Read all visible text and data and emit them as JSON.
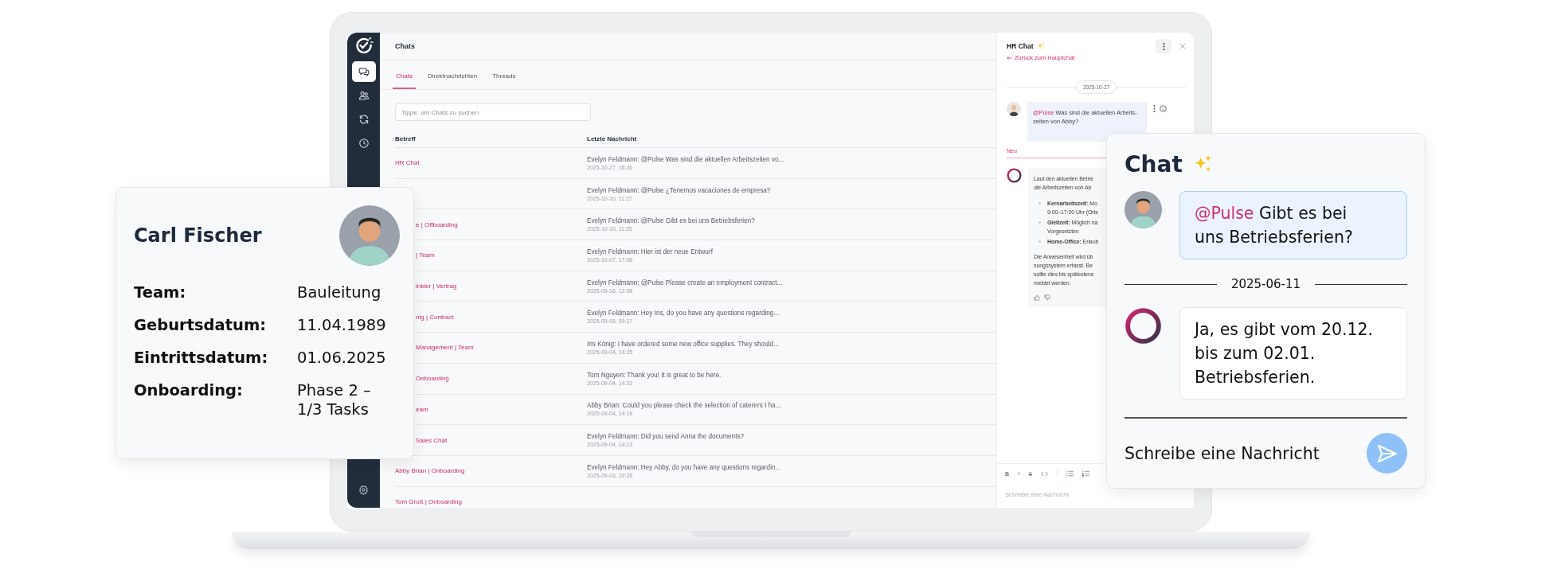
{
  "sidebar": {
    "items": [
      {
        "selected": true
      },
      {
        "selected": false
      },
      {
        "selected": false
      },
      {
        "selected": false
      }
    ]
  },
  "chats": {
    "title": "Chats",
    "tabs": [
      {
        "label": "Chats",
        "selected": true
      },
      {
        "label": "Direktnachrichten",
        "selected": false
      },
      {
        "label": "Threads",
        "selected": false
      }
    ],
    "search": {
      "placeholder": "Tippe, um Chats zu suchen"
    },
    "columns": [
      "Betreff",
      "Letzte Nachricht"
    ],
    "rows": [
      {
        "subject": "HR Chat",
        "covered": false,
        "message": "Evelyn Feldmann: @Pulse Was sind die aktuellen Arbeitszeiten vo...",
        "time": "2025-10-27, 16:26"
      },
      {
        "message": "Evelyn Feldmann: @Pulse ¿Tenemos vacaciones de empresa?",
        "time": "2025-10-10, 11:27"
      },
      {
        "subject": "e | Offboarding",
        "covered": true,
        "message": "Evelyn Feldmann: @Pulse Gibt es bei uns Betriebsferien?",
        "time": "2025-10-10, 11:25"
      },
      {
        "subject": "| Team",
        "covered": true,
        "message": "Evelyn Feldmann: Hier ist der neue Entwurf",
        "time": "2025-10-07, 17:08"
      },
      {
        "subject": "inkler | Vertrag",
        "covered": true,
        "message": "Evelyn Feldmann: @Pulse Please create an employment contract...",
        "time": "2025-09-16, 12:08"
      },
      {
        "subject": "nig | Contract",
        "covered": true,
        "message": "Evelyn Feldmann: Hey Iris, do you have any questions regarding...",
        "time": "2025-09-08, 09:27"
      },
      {
        "subject": "Management | Team",
        "covered": true,
        "message": "Iris König: I have ordered some new office supplies. They should...",
        "time": "2025-09-04, 14:25"
      },
      {
        "subject": "Onboarding",
        "covered": true,
        "message": "Tom Nguyen: Thank you! It is great to be here.",
        "time": "2025-09-04, 14:22"
      },
      {
        "subject": "eam",
        "covered": true,
        "message": "Abby Brian: Could you please check the selection of caterers I ha...",
        "time": "2025-09-04, 14:18"
      },
      {
        "subject": "Sales Chat",
        "covered": true,
        "message": "Evelyn Feldmann: Did you send Anna the documents?",
        "time": "2025-09-04, 14:13"
      },
      {
        "subject": "Abby Brian | Onboarding",
        "covered": false,
        "message": "Evelyn Feldmann: Hey Abby, do you have any questions regardin...",
        "time": "2025-09-03, 10:28"
      },
      {
        "subject": "Tom Groß | Onboarding",
        "covered": false
      }
    ]
  },
  "hr_chat": {
    "title": "HR Chat",
    "back_link": "Zurück zum Hauptchat",
    "date": "2025-10-27",
    "question": {
      "mention": "@Pulse",
      "text": "Was sind die aktuellen Arbeits-zeiten von Abby?"
    },
    "new_marker": "Neu",
    "answer": {
      "blocks": [
        {
          "kind": "text",
          "lines": [
            "Laut den aktuellen Betrie",
            "die Arbeitszeiten von Ab"
          ]
        },
        {
          "kind": "bullet",
          "lines": [
            "**Kernarbeitszeit:** Mo",
            "9:00–17:00 Uhr (Orts"
          ]
        },
        {
          "kind": "bullet",
          "lines": [
            "**Gleitzeit:** Möglich na",
            "Vorgesetzten"
          ]
        },
        {
          "kind": "bullet",
          "lines": [
            "**Home-Office:** Erlaub"
          ]
        },
        {
          "kind": "text",
          "lines": [
            "Die Anwesenheit wird üb",
            "sungssystem erfasst. Be",
            "sollte dies bis spätestens",
            "meldet werden."
          ]
        }
      ]
    },
    "toolbar": [
      {
        "label": "B",
        "kind": "bold"
      },
      {
        "label": "I",
        "kind": "italic"
      },
      {
        "label": "S",
        "kind": "strike"
      }
    ],
    "composer": {
      "placeholder": "Schreibe eine Nachricht"
    }
  },
  "profile_card": {
    "name": "Carl Fischer",
    "fields": [
      {
        "label": "Team:",
        "value": "Bauleitung"
      },
      {
        "label": "Geburtsdatum:",
        "value": "11.04.1989"
      },
      {
        "label": "Eintrittsdatum:",
        "value": "01.06.2025"
      },
      {
        "label": "Onboarding:",
        "value": "Phase 2 – 1/3 Tasks"
      }
    ]
  },
  "chat_card": {
    "title": "Chat",
    "question": {
      "mention": "@Pulse",
      "text": "Gibt es bei uns Betriebsferien?"
    },
    "date": "2025-06-11",
    "answer": "Ja, es gibt vom 20.12. bis zum 02.01. Betriebsferien.",
    "composer": {
      "placeholder": "Schreibe eine Nachricht"
    }
  }
}
